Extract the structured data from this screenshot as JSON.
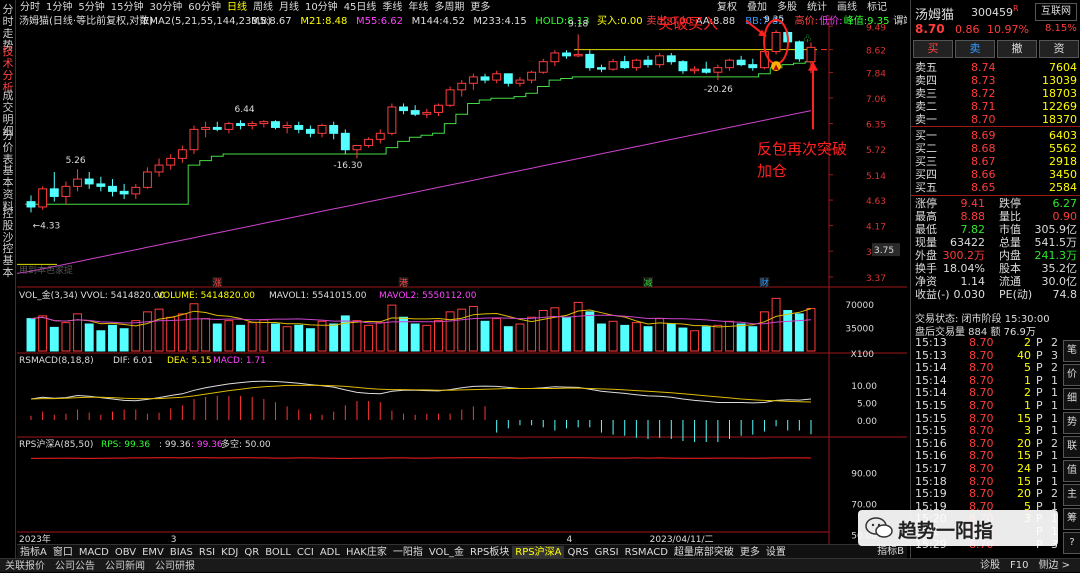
{
  "left_tabs": [
    "分时走势",
    "技术分析",
    "成交明细",
    "分价表",
    "基本资料",
    "控股沙",
    "控基本"
  ],
  "periods": [
    "分时",
    "1分钟",
    "5分钟",
    "15分钟",
    "30分钟",
    "60分钟",
    "日线",
    "周线",
    "月线",
    "10分钟",
    "45日线",
    "季线",
    "年线",
    "多周期",
    "更多"
  ],
  "active_period": "日线",
  "toolbar": [
    "复权",
    "叠加",
    "多股",
    "统计",
    "画线",
    "标记"
  ],
  "main": {
    "title": "汤姆猫(日线·等比前复权,对数)",
    "ema_label": "EMA2(5,21,55,144,233,8)",
    "indicators": [
      {
        "label": "M5:",
        "value": "8.67",
        "color": "#dddddd"
      },
      {
        "label": "M21:",
        "value": "8.48",
        "color": "#ffff00"
      },
      {
        "label": "M55:",
        "value": "6.62",
        "color": "#ff44ff"
      },
      {
        "label": "M144:",
        "value": "4.52",
        "color": "#dddddd"
      },
      {
        "label": "M233:",
        "value": "4.15",
        "color": "#dddddd"
      },
      {
        "label": "HOLD:",
        "value": "8.13",
        "color": "#33ff33"
      },
      {
        "label": "买入:",
        "value": "0.00",
        "color": "#ffff00"
      },
      {
        "label": "卖出:",
        "value": "0.00",
        "color": "#ff4444"
      },
      {
        "label": "AA:",
        "value": "8.88",
        "color": "#dddddd"
      },
      {
        "label": "BB:",
        "value": "7.82",
        "color": "#3399ff"
      },
      {
        "label": "高价:",
        "value": "",
        "color": "#ff4444"
      },
      {
        "label": "低价:",
        "value": "",
        "color": "#ff44ff"
      },
      {
        "label": "峰值:",
        "value": "9.35",
        "color": "#33ff33"
      },
      {
        "label": "谓端:",
        "value": "",
        "color": "#dddddd"
      }
    ],
    "price_labels": [
      "9.49",
      "8.62",
      "7.84",
      "7.06",
      "6.35",
      "5.72",
      "5.14",
      "4.63",
      "4.17",
      "3.75",
      "3.37"
    ],
    "current_price_tag": "3.75",
    "date_labels": [
      "2023年",
      "3",
      "4",
      "2023/04/11/二"
    ],
    "event_marks": [
      {
        "text": "涨",
        "color": "#ff4444"
      },
      {
        "text": "港",
        "color": "#ff4444"
      },
      {
        "text": "减",
        "color": "#33cc33"
      },
      {
        "text": "财",
        "color": "#3399ff"
      }
    ],
    "annotations": {
      "a1": "5.26",
      "a2": "←4.33",
      "a3": "6.44",
      "a4": "-16.30",
      "a5": "9.18",
      "a6": "-20.26",
      "a7": "9.35"
    },
    "red_text": {
      "buy": "突破买入",
      "add1": "反包再次突破",
      "add2": "加仓"
    },
    "faded": "用到本色家提"
  },
  "chart_data": {
    "type": "candlestick",
    "y_scale": "log",
    "ylim": [
      3.37,
      9.7
    ],
    "up_color": "#ff3c3c",
    "down_color": "#54ffff",
    "candles": [
      [
        4.6,
        4.72,
        4.4,
        4.5
      ],
      [
        4.5,
        4.9,
        4.45,
        4.85
      ],
      [
        4.85,
        5.2,
        4.6,
        4.7
      ],
      [
        4.7,
        5.0,
        4.55,
        4.9
      ],
      [
        4.9,
        5.26,
        4.8,
        5.05
      ],
      [
        5.05,
        5.2,
        4.85,
        4.95
      ],
      [
        4.95,
        5.1,
        4.8,
        4.9
      ],
      [
        4.9,
        5.05,
        4.7,
        4.8
      ],
      [
        4.8,
        4.95,
        4.65,
        4.75
      ],
      [
        4.75,
        4.95,
        4.65,
        4.88
      ],
      [
        4.88,
        5.3,
        4.85,
        5.2
      ],
      [
        5.2,
        5.5,
        5.1,
        5.35
      ],
      [
        5.35,
        5.6,
        5.25,
        5.5
      ],
      [
        5.5,
        5.8,
        5.4,
        5.7
      ],
      [
        5.7,
        6.3,
        5.6,
        6.2
      ],
      [
        6.2,
        6.4,
        6.0,
        6.25
      ],
      [
        6.25,
        6.4,
        6.15,
        6.2
      ],
      [
        6.2,
        6.4,
        6.1,
        6.35
      ],
      [
        6.35,
        6.44,
        6.2,
        6.3
      ],
      [
        6.3,
        6.42,
        6.2,
        6.35
      ],
      [
        6.35,
        6.44,
        6.25,
        6.4
      ],
      [
        6.4,
        6.44,
        6.2,
        6.25
      ],
      [
        6.25,
        6.4,
        6.1,
        6.3
      ],
      [
        6.3,
        6.4,
        6.1,
        6.2
      ],
      [
        6.2,
        6.3,
        6.0,
        6.1
      ],
      [
        6.1,
        6.35,
        6.0,
        6.3
      ],
      [
        6.3,
        6.4,
        5.95,
        6.1
      ],
      [
        6.1,
        6.2,
        5.6,
        5.7
      ],
      [
        5.7,
        5.8,
        5.5,
        5.8
      ],
      [
        5.8,
        6.0,
        5.75,
        5.95
      ],
      [
        5.95,
        6.2,
        5.85,
        6.1
      ],
      [
        6.1,
        6.9,
        6.05,
        6.8
      ],
      [
        6.8,
        6.9,
        6.6,
        6.7
      ],
      [
        6.7,
        6.85,
        6.55,
        6.6
      ],
      [
        6.6,
        6.75,
        6.5,
        6.65
      ],
      [
        6.65,
        6.9,
        6.55,
        6.85
      ],
      [
        6.85,
        7.4,
        6.8,
        7.3
      ],
      [
        7.3,
        7.6,
        7.1,
        7.5
      ],
      [
        7.5,
        7.8,
        7.3,
        7.7
      ],
      [
        7.7,
        7.8,
        7.5,
        7.6
      ],
      [
        7.6,
        7.9,
        7.5,
        7.8
      ],
      [
        7.8,
        7.8,
        7.4,
        7.5
      ],
      [
        7.5,
        7.7,
        7.4,
        7.6
      ],
      [
        7.6,
        7.9,
        7.5,
        7.85
      ],
      [
        7.85,
        8.3,
        7.8,
        8.2
      ],
      [
        8.2,
        8.6,
        8.05,
        8.5
      ],
      [
        8.5,
        8.6,
        8.3,
        8.4
      ],
      [
        8.4,
        9.18,
        8.35,
        8.45
      ],
      [
        8.45,
        8.6,
        7.9,
        8.0
      ],
      [
        8.0,
        8.1,
        7.85,
        7.95
      ],
      [
        7.95,
        8.3,
        7.9,
        8.2
      ],
      [
        8.2,
        8.4,
        7.95,
        8.0
      ],
      [
        8.0,
        8.3,
        7.9,
        8.25
      ],
      [
        8.25,
        8.4,
        8.0,
        8.1
      ],
      [
        8.1,
        8.5,
        8.0,
        8.4
      ],
      [
        8.4,
        8.5,
        8.1,
        8.2
      ],
      [
        8.2,
        8.25,
        7.8,
        7.9
      ],
      [
        7.9,
        8.05,
        7.8,
        7.95
      ],
      [
        7.95,
        8.2,
        7.8,
        7.85
      ],
      [
        7.85,
        8.1,
        7.6,
        8.0
      ],
      [
        8.0,
        8.3,
        7.9,
        8.25
      ],
      [
        8.25,
        8.4,
        8.05,
        8.1
      ],
      [
        8.1,
        8.3,
        7.9,
        8.0
      ],
      [
        8.0,
        8.6,
        7.95,
        8.55
      ],
      [
        8.55,
        9.35,
        8.45,
        9.25
      ],
      [
        9.25,
        9.3,
        8.85,
        8.9
      ],
      [
        8.9,
        8.95,
        8.2,
        8.3
      ],
      [
        8.2,
        8.88,
        7.82,
        8.7
      ]
    ],
    "volume": {
      "ylabel_ticks": [
        "70000",
        "35000",
        "X100"
      ],
      "values": [
        48,
        52,
        35,
        42,
        55,
        40,
        30,
        38,
        33,
        45,
        58,
        62,
        50,
        55,
        70,
        48,
        40,
        45,
        38,
        42,
        46,
        40,
        36,
        38,
        33,
        44,
        40,
        52,
        45,
        38,
        42,
        68,
        50,
        40,
        38,
        45,
        58,
        62,
        66,
        44,
        48,
        36,
        40,
        50,
        60,
        64,
        50,
        72,
        58,
        40,
        44,
        38,
        42,
        36,
        48,
        40,
        34,
        30,
        36,
        38,
        44,
        40,
        36,
        58,
        78,
        60,
        55,
        63
      ]
    },
    "macd": {
      "yticks": [
        "10.00",
        "5.00",
        "0.00"
      ],
      "dif": [
        6,
        6.5,
        6.2,
        6.4,
        7,
        6.8,
        6.4,
        6,
        5.6,
        5.5,
        5.9,
        6.4,
        7,
        7.5,
        8.5,
        9.2,
        9.8,
        10.3,
        10.7,
        11,
        11.1,
        11,
        10.8,
        10.5,
        10.1,
        9.8,
        9.4,
        8.6,
        7.9,
        7.6,
        7.5,
        8.2,
        8.5,
        8.5,
        8.4,
        8.3,
        8.7,
        9.2,
        9.6,
        9.7,
        9.6,
        9.3,
        9,
        9,
        9.2,
        9.5,
        9.4,
        9.3,
        8.8,
        8.2,
        7.9,
        7.6,
        7.2,
        6.9,
        6.8,
        6.5,
        6,
        5.6,
        5.3,
        5,
        5,
        5,
        4.9,
        5,
        5.6,
        5.8,
        5.7,
        6.01
      ],
      "dea": [
        6,
        6.1,
        6.1,
        6.2,
        6.4,
        6.5,
        6.5,
        6.4,
        6.2,
        6.1,
        6.1,
        6.1,
        6.3,
        6.5,
        6.9,
        7.4,
        7.9,
        8.4,
        8.8,
        9.2,
        9.5,
        9.7,
        9.9,
        9.9,
        9.9,
        9.9,
        9.8,
        9.6,
        9.3,
        9,
        8.8,
        8.7,
        8.7,
        8.6,
        8.6,
        8.5,
        8.5,
        8.6,
        8.7,
        8.8,
        8.9,
        9,
        9,
        9,
        9,
        9,
        9.1,
        9.1,
        9,
        8.9,
        8.8,
        8.6,
        8.4,
        8.2,
        8,
        7.8,
        7.5,
        7.2,
        6.9,
        6.6,
        6.3,
        6,
        5.8,
        5.6,
        5.5,
        5.3,
        5.2,
        5.15
      ]
    },
    "rps": {
      "yticks": [
        "90.00",
        "70.00",
        "50.00"
      ],
      "values": [
        99.1,
        99.2,
        99.2,
        99.3,
        99.2,
        99.1,
        99.2,
        99.3,
        99.3,
        99.4,
        99.4,
        99.5,
        99.5,
        99.4,
        99.5,
        99.5,
        99.4,
        99.4,
        99.5,
        99.5,
        99.4,
        99.3,
        99.3,
        99.4,
        99.4,
        99.3,
        99.2,
        99.1,
        99.2,
        99.3,
        99.3,
        99.4,
        99.4,
        99.3,
        99.3,
        99.4,
        99.4,
        99.5,
        99.5,
        99.5,
        99.4,
        99.4,
        99.3,
        99.4,
        99.4,
        99.5,
        99.5,
        99.5,
        99.4,
        99.3,
        99.3,
        99.3,
        99.4,
        99.3,
        99.4,
        99.3,
        99.2,
        99.2,
        99.2,
        99.3,
        99.3,
        99.3,
        99.2,
        99.3,
        99.4,
        99.4,
        99.4,
        99.36
      ]
    }
  },
  "volume_header": {
    "name": "VOL_金(3,34)",
    "vvol": "VVOL: 5414820.00",
    "volume": "VOLUME: 5414820.00",
    "mavol1": "MAVOL1: 5541015.00",
    "mavol2": "MAVOL2: 5550112.00"
  },
  "macd_header": {
    "name": "RSMACD(8,18,8)",
    "dif": "DIF: 6.01",
    "dea": "DEA: 5.15",
    "macd": "MACD: 1.71"
  },
  "rps_header": {
    "name": "RPS沪深A(85,50)",
    "rps": "RPS: 99.36",
    "v1": ": 99.36",
    "v2": ": 99.36",
    "v3": "多空: 50.00"
  },
  "bottom_tabs": [
    "指标A",
    "窗口",
    "MACD",
    "OBV",
    "EMV",
    "BIAS",
    "RSI",
    "KDJ",
    "QR",
    "BOLL",
    "CCI",
    "ADL",
    "HAK庄家",
    "一阳指",
    "VOL_金",
    "RPS板块",
    "RPS沪深A",
    "QRS",
    "GRSI",
    "RSMACD",
    "超量席部突破",
    "更多",
    "设置"
  ],
  "selected_bottom_tab": "RPS沪深A",
  "footer": [
    "关联报价",
    "公司公告",
    "公司新闻",
    "公司研报"
  ],
  "footer_right": [
    "诊股",
    "F10",
    "侧边 >"
  ],
  "right_panel": {
    "stock_name": "汤姆猫",
    "stock_code": "300459",
    "rtag": "R",
    "hulian": "互联网",
    "price": "8.70",
    "change": "0.86",
    "pct": "10.97%",
    "pct2": "8.15%",
    "buttons": [
      "买",
      "卖",
      "撤",
      "资"
    ],
    "asks": [
      {
        "n": "卖五",
        "p": "8.74",
        "v": "7604"
      },
      {
        "n": "卖四",
        "p": "8.73",
        "v": "13039"
      },
      {
        "n": "卖三",
        "p": "8.72",
        "v": "18703"
      },
      {
        "n": "卖二",
        "p": "8.71",
        "v": "12269"
      },
      {
        "n": "卖一",
        "p": "8.70",
        "v": "18370"
      }
    ],
    "bids": [
      {
        "n": "买一",
        "p": "8.69",
        "v": "6403"
      },
      {
        "n": "买二",
        "p": "8.68",
        "v": "5562"
      },
      {
        "n": "买三",
        "p": "8.67",
        "v": "2918"
      },
      {
        "n": "买四",
        "p": "8.66",
        "v": "3450"
      },
      {
        "n": "买五",
        "p": "8.65",
        "v": "2584"
      }
    ],
    "stats": [
      {
        "l1": "涨停",
        "v1": "9.41",
        "c1": "red",
        "l2": "跌停",
        "v2": "6.27",
        "c2": "grn"
      },
      {
        "l1": "最高",
        "v1": "8.88",
        "c1": "red",
        "l2": "量比",
        "v2": "0.90",
        "c2": "red"
      },
      {
        "l1": "最低",
        "v1": "7.82",
        "c1": "grn",
        "l2": "市值",
        "v2": "305.9亿",
        "c2": "wht"
      },
      {
        "l1": "现量",
        "v1": "63422",
        "c1": "wht",
        "l2": "总量",
        "v2": "541.5万",
        "c2": "wht"
      },
      {
        "l1": "外盘",
        "v1": "300.2万",
        "c1": "red",
        "l2": "内盘",
        "v2": "241.3万",
        "c2": "grn"
      },
      {
        "l1": "换手",
        "v1": "18.04%",
        "c1": "wht",
        "l2": "股本",
        "v2": "35.2亿",
        "c2": "wht"
      },
      {
        "l1": "净资",
        "v1": "1.14",
        "c1": "wht",
        "l2": "流通",
        "v2": "30.0亿",
        "c2": "wht"
      },
      {
        "l1": "收益(-)",
        "v1": "0.030",
        "c1": "wht",
        "l2": "PE(动)",
        "v2": "74.8",
        "c2": "wht"
      }
    ],
    "trade_status": "交易状态: 闭市阶段 15:30:00",
    "after_vol": "盘后交易量 884 额 76.9万",
    "ticks": [
      {
        "t": "15:13",
        "p": "8.70",
        "v": "2",
        "f": "P",
        "n": "2"
      },
      {
        "t": "15:13",
        "p": "8.70",
        "v": "40",
        "f": "P",
        "n": "3"
      },
      {
        "t": "15:14",
        "p": "8.70",
        "v": "5",
        "f": "P",
        "n": "2"
      },
      {
        "t": "15:14",
        "p": "8.70",
        "v": "1",
        "f": "P",
        "n": "1"
      },
      {
        "t": "15:14",
        "p": "8.70",
        "v": "2",
        "f": "P",
        "n": "1"
      },
      {
        "t": "15:15",
        "p": "8.70",
        "v": "1",
        "f": "P",
        "n": "1"
      },
      {
        "t": "15:15",
        "p": "8.70",
        "v": "15",
        "f": "P",
        "n": "1"
      },
      {
        "t": "15:15",
        "p": "8.70",
        "v": "3",
        "f": "P",
        "n": "1"
      },
      {
        "t": "15:16",
        "p": "8.70",
        "v": "20",
        "f": "P",
        "n": "2"
      },
      {
        "t": "15:16",
        "p": "8.70",
        "v": "15",
        "f": "P",
        "n": "1"
      },
      {
        "t": "15:17",
        "p": "8.70",
        "v": "24",
        "f": "P",
        "n": "1"
      },
      {
        "t": "15:18",
        "p": "8.70",
        "v": "15",
        "f": "P",
        "n": "1"
      },
      {
        "t": "15:19",
        "p": "8.70",
        "v": "20",
        "f": "P",
        "n": "2"
      },
      {
        "t": "15:19",
        "p": "8.70",
        "v": "5",
        "f": "P",
        "n": "1"
      },
      {
        "t": "15:20",
        "p": "8.70",
        "v": "3",
        "f": "P",
        "n": "1"
      },
      {
        "t": "15:2",
        "p": "8.70",
        "v": "",
        "f": "P",
        "n": "1"
      },
      {
        "t": "15:29",
        "p": "8.70",
        "v": "",
        "f": "P",
        "n": "3"
      }
    ],
    "side_tabs": [
      "笔",
      "价",
      "细",
      "势",
      "联",
      "值",
      "主",
      "筹",
      "?"
    ]
  },
  "watermark": "趋势一阳指"
}
